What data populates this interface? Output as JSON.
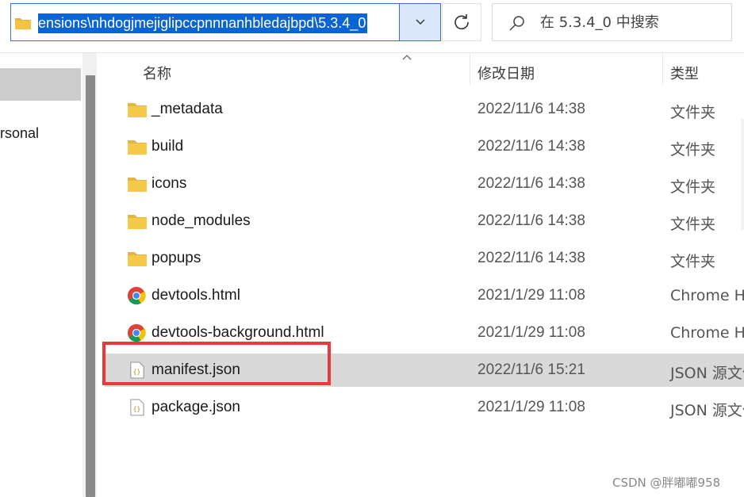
{
  "address_bar": {
    "path": "ensions\\nhdogjmejiglipccpnnnanhbledajbpd\\5.3.4_0"
  },
  "search": {
    "placeholder": "在 5.3.4_0 中搜索"
  },
  "nav": {
    "partial_item": "rsonal"
  },
  "columns": {
    "name": "名称",
    "date": "修改日期",
    "type": "类型"
  },
  "files": [
    {
      "name": "_metadata",
      "date": "2022/11/6 14:38",
      "type": "文件夹",
      "icon": "folder-icon"
    },
    {
      "name": "build",
      "date": "2022/11/6 14:38",
      "type": "文件夹",
      "icon": "folder-icon"
    },
    {
      "name": "icons",
      "date": "2022/11/6 14:38",
      "type": "文件夹",
      "icon": "folder-icon"
    },
    {
      "name": "node_modules",
      "date": "2022/11/6 14:38",
      "type": "文件夹",
      "icon": "folder-icon"
    },
    {
      "name": "popups",
      "date": "2022/11/6 14:38",
      "type": "文件夹",
      "icon": "folder-icon"
    },
    {
      "name": "devtools.html",
      "date": "2021/1/29 11:08",
      "type": "Chrome HT",
      "icon": "chrome-icon"
    },
    {
      "name": "devtools-background.html",
      "date": "2021/1/29 11:08",
      "type": "Chrome HT",
      "icon": "chrome-icon"
    },
    {
      "name": "manifest.json",
      "date": "2022/11/6 15:21",
      "type": "JSON 源文件",
      "icon": "json-file-icon",
      "selected": true
    },
    {
      "name": "package.json",
      "date": "2021/1/29 11:08",
      "type": "JSON 源文件",
      "icon": "json-file-icon"
    }
  ],
  "watermark": "CSDN @胖嘟嘟958",
  "colors": {
    "selection": "#d9d9d9",
    "highlight_box": "#e83a3a",
    "address_highlight": "#0a64d6",
    "folder": "#f5c242"
  }
}
